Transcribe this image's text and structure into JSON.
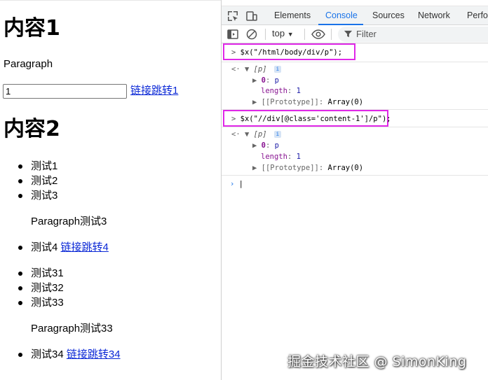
{
  "page": {
    "heading1": "内容1",
    "paragraph1": "Paragraph",
    "input_value": "1",
    "link1": "链接跳转1",
    "heading2": "内容2",
    "list_a": [
      "测试1",
      "测试2",
      "测试3"
    ],
    "sub_paragraph_a": "Paragraph测试3",
    "item4_text": "测试4",
    "item4_link": "链接跳转4",
    "list_b": [
      "测试31",
      "测试32",
      "测试33"
    ],
    "sub_paragraph_b": "Paragraph测试33",
    "item34_text": "测试34",
    "item34_link": "链接跳转34"
  },
  "devtools": {
    "tabs": [
      "Elements",
      "Console",
      "Sources",
      "Network",
      "Perfo"
    ],
    "active_tab": "Console",
    "context": "top",
    "filter_placeholder": "Filter",
    "console": {
      "cmd1": "$x(\"/html/body/div/p\");",
      "cmd2": "$x(\"//div[@class='content-1']/p\");",
      "result_label": "[p]",
      "item_key": "0",
      "item_val": "p",
      "length_key": "length",
      "length_val": "1",
      "proto_key": "[[Prototype]]",
      "proto_val": "Array(0)",
      "prompt_gt": ">",
      "return_arrow": "<·",
      "caret": "|"
    }
  },
  "watermark": "掘金技术社区 @ SimonKing",
  "colors": {
    "accent": "#1a73e8",
    "highlight_box": "#e028e8",
    "link": "#0b28d6"
  }
}
